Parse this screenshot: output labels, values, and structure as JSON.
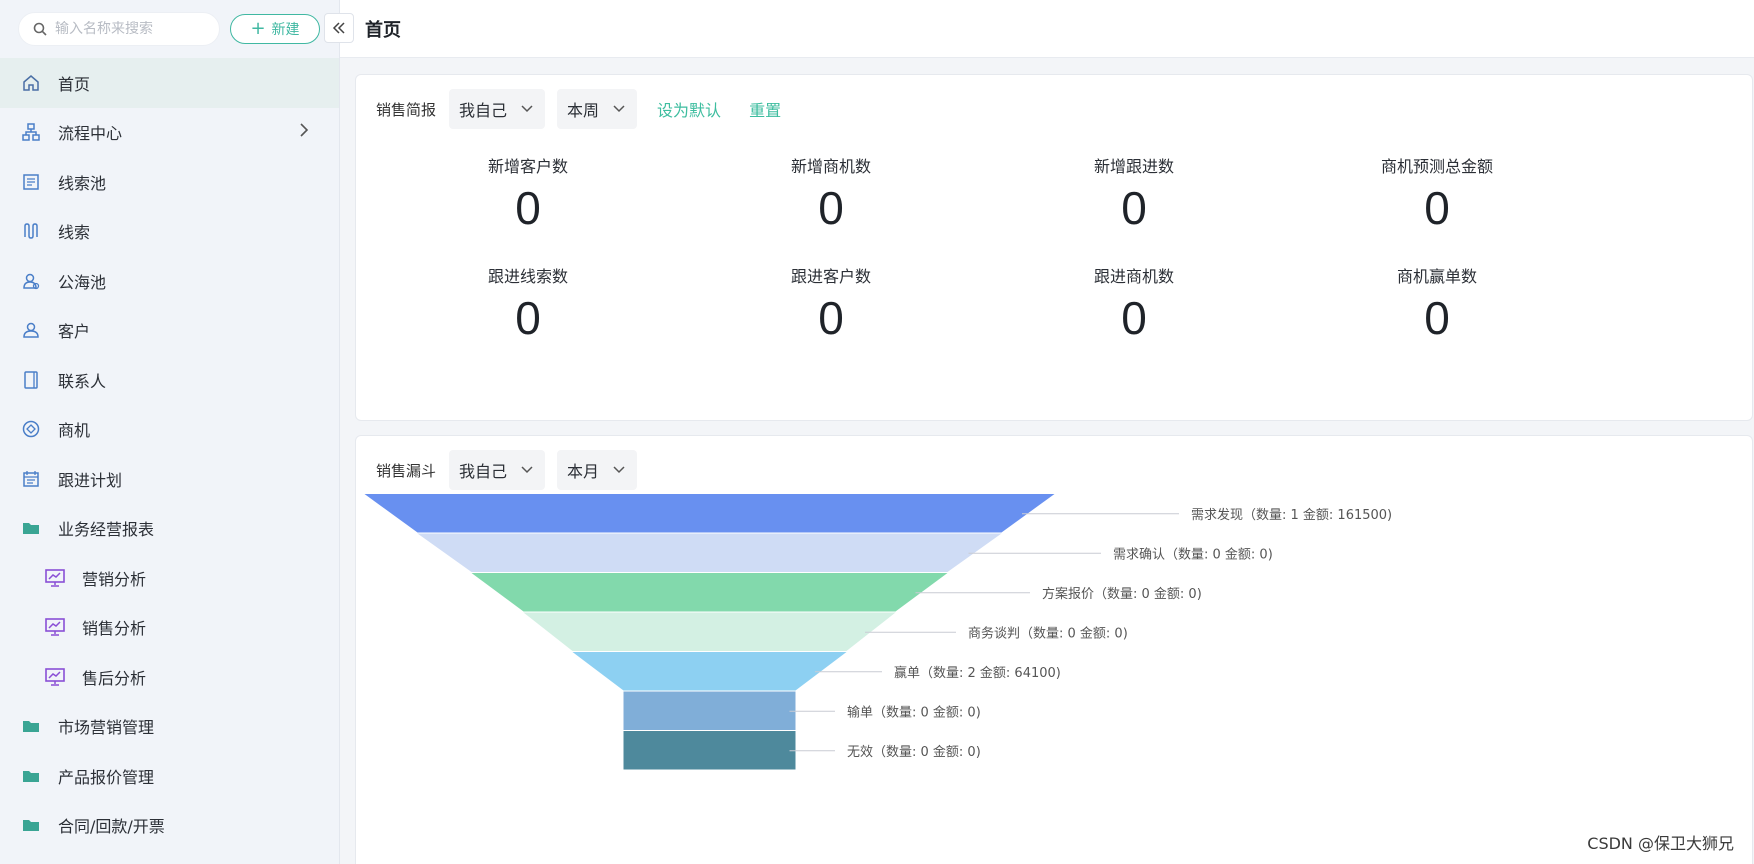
{
  "sidebar": {
    "search_placeholder": "输入名称来搜索",
    "new_button": "新建",
    "items": [
      {
        "label": "首页",
        "icon": "home-icon"
      },
      {
        "label": "流程中心",
        "icon": "flow-icon"
      },
      {
        "label": "线索池",
        "icon": "list-icon"
      },
      {
        "label": "线索",
        "icon": "path-icon"
      },
      {
        "label": "公海池",
        "icon": "users-icon"
      },
      {
        "label": "客户",
        "icon": "user-icon"
      },
      {
        "label": "联系人",
        "icon": "contacts-icon"
      },
      {
        "label": "商机",
        "icon": "target-icon"
      },
      {
        "label": "跟进计划",
        "icon": "calendar-icon"
      },
      {
        "label": "业务经营报表",
        "icon": "folder-icon"
      },
      {
        "label": "营销分析",
        "icon": "monitor-chart-icon"
      },
      {
        "label": "销售分析",
        "icon": "monitor-chart-icon"
      },
      {
        "label": "售后分析",
        "icon": "monitor-chart-icon"
      },
      {
        "label": "市场营销管理",
        "icon": "folder-icon"
      },
      {
        "label": "产品报价管理",
        "icon": "folder-icon"
      },
      {
        "label": "合同/回款/开票",
        "icon": "folder-icon"
      }
    ]
  },
  "header": {
    "title": "首页"
  },
  "sales_brief": {
    "label": "销售简报",
    "scope": "我自己",
    "period": "本周",
    "set_default": "设为默认",
    "reset": "重置",
    "stats": [
      {
        "label": "新增客户数",
        "value": "0"
      },
      {
        "label": "新增商机数",
        "value": "0"
      },
      {
        "label": "新增跟进数",
        "value": "0"
      },
      {
        "label": "商机预测总金额",
        "value": "0"
      },
      {
        "label": "跟进线索数",
        "value": "0"
      },
      {
        "label": "跟进客户数",
        "value": "0"
      },
      {
        "label": "跟进商机数",
        "value": "0"
      },
      {
        "label": "商机赢单数",
        "value": "0"
      }
    ]
  },
  "sales_funnel": {
    "label": "销售漏斗",
    "scope": "我自己",
    "period": "本月"
  },
  "chart_data": {
    "type": "funnel",
    "stages": [
      {
        "label": "需求发现（数量: 1 金额: 161500)",
        "name": "需求发现",
        "count": 1,
        "amount": 161500,
        "color": "#6890f0"
      },
      {
        "label": "需求确认（数量: 0 金额: 0)",
        "name": "需求确认",
        "count": 0,
        "amount": 0,
        "color": "#cfdcf5"
      },
      {
        "label": "方案报价（数量: 0 金额: 0)",
        "name": "方案报价",
        "count": 0,
        "amount": 0,
        "color": "#82d9ac"
      },
      {
        "label": "商务谈判（数量: 0 金额: 0)",
        "name": "商务谈判",
        "count": 0,
        "amount": 0,
        "color": "#d3f0e3"
      },
      {
        "label": "赢单（数量: 2 金额: 64100)",
        "name": "赢单",
        "count": 2,
        "amount": 64100,
        "color": "#8dd0f2"
      },
      {
        "label": "输单（数量: 0 金额: 0)",
        "name": "输单",
        "count": 0,
        "amount": 0,
        "color": "#80aed8"
      },
      {
        "label": "无效（数量: 0 金额: 0)",
        "name": "无效",
        "count": 0,
        "amount": 0,
        "color": "#4e899c"
      }
    ]
  },
  "watermark": "CSDN @保卫大狮兄"
}
